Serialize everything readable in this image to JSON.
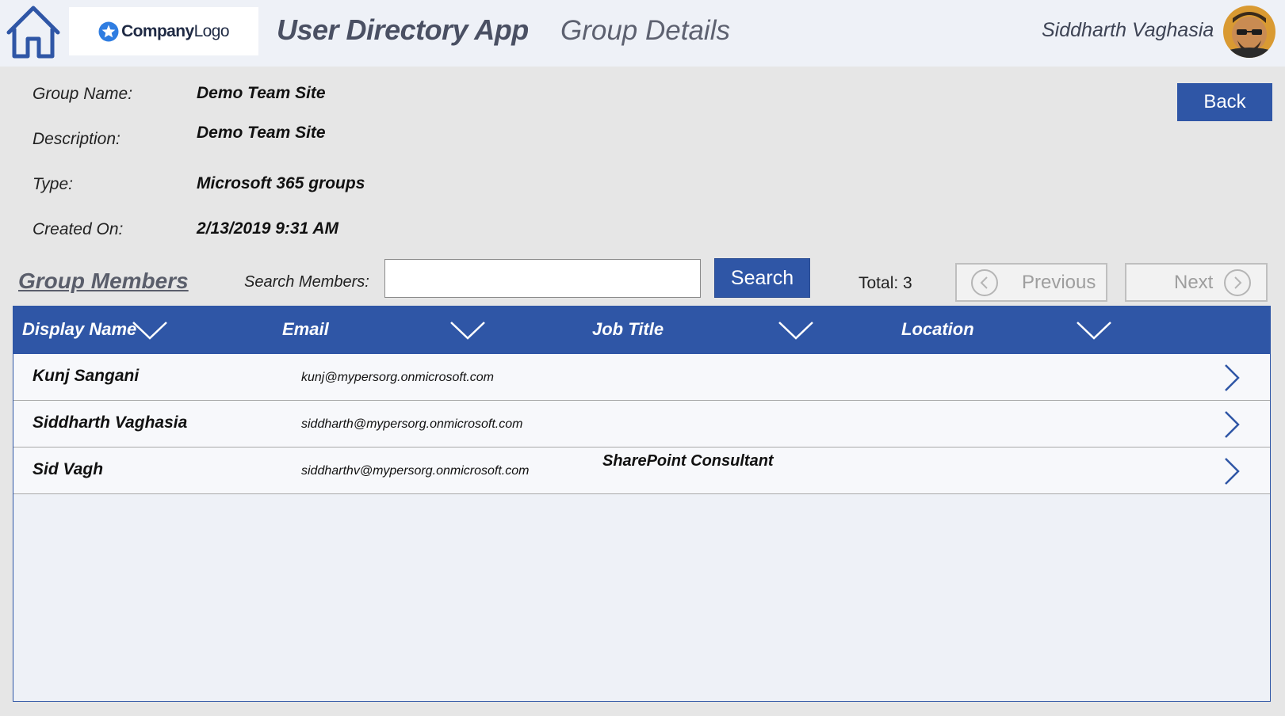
{
  "header": {
    "logo_prefix": "Company",
    "logo_suffix": "Logo",
    "app_title": "User Directory App",
    "page_title": "Group Details",
    "user_name": "Siddharth Vaghasia"
  },
  "details": {
    "group_name_label": "Group Name:",
    "group_name": "Demo Team Site",
    "description_label": "Description:",
    "description": "Demo Team Site",
    "type_label": "Type:",
    "type": "Microsoft 365 groups",
    "created_label": "Created On:",
    "created": "2/13/2019 9:31 AM",
    "back_label": "Back"
  },
  "members": {
    "title": "Group Members",
    "search_label": "Search Members:",
    "search_value": "",
    "search_button": "Search",
    "total_text": "Total: 3",
    "previous_label": "Previous",
    "next_label": "Next"
  },
  "grid": {
    "columns": [
      "Display Name",
      "Email",
      "Job Title",
      "Location"
    ],
    "rows": [
      {
        "name": "Kunj Sangani",
        "email": "kunj@mypersorg.onmicrosoft.com",
        "job": "",
        "location": ""
      },
      {
        "name": "Siddharth Vaghasia",
        "email": "siddharth@mypersorg.onmicrosoft.com",
        "job": "",
        "location": ""
      },
      {
        "name": "Sid Vagh",
        "email": "siddharthv@mypersorg.onmicrosoft.com",
        "job": "SharePoint Consultant",
        "location": ""
      }
    ]
  },
  "colors": {
    "accent": "#2f56a6",
    "header_bg": "#eef1f7",
    "page_bg": "#e6e6e6",
    "disabled_text": "#9e9e9e"
  },
  "icons": {
    "home": "home-icon",
    "logo": "star-icon",
    "avatar": "user-avatar",
    "sort": "chevron-down-icon",
    "row_nav": "chevron-right-icon",
    "prev": "chevron-left-circle-icon",
    "next": "chevron-right-circle-icon"
  }
}
